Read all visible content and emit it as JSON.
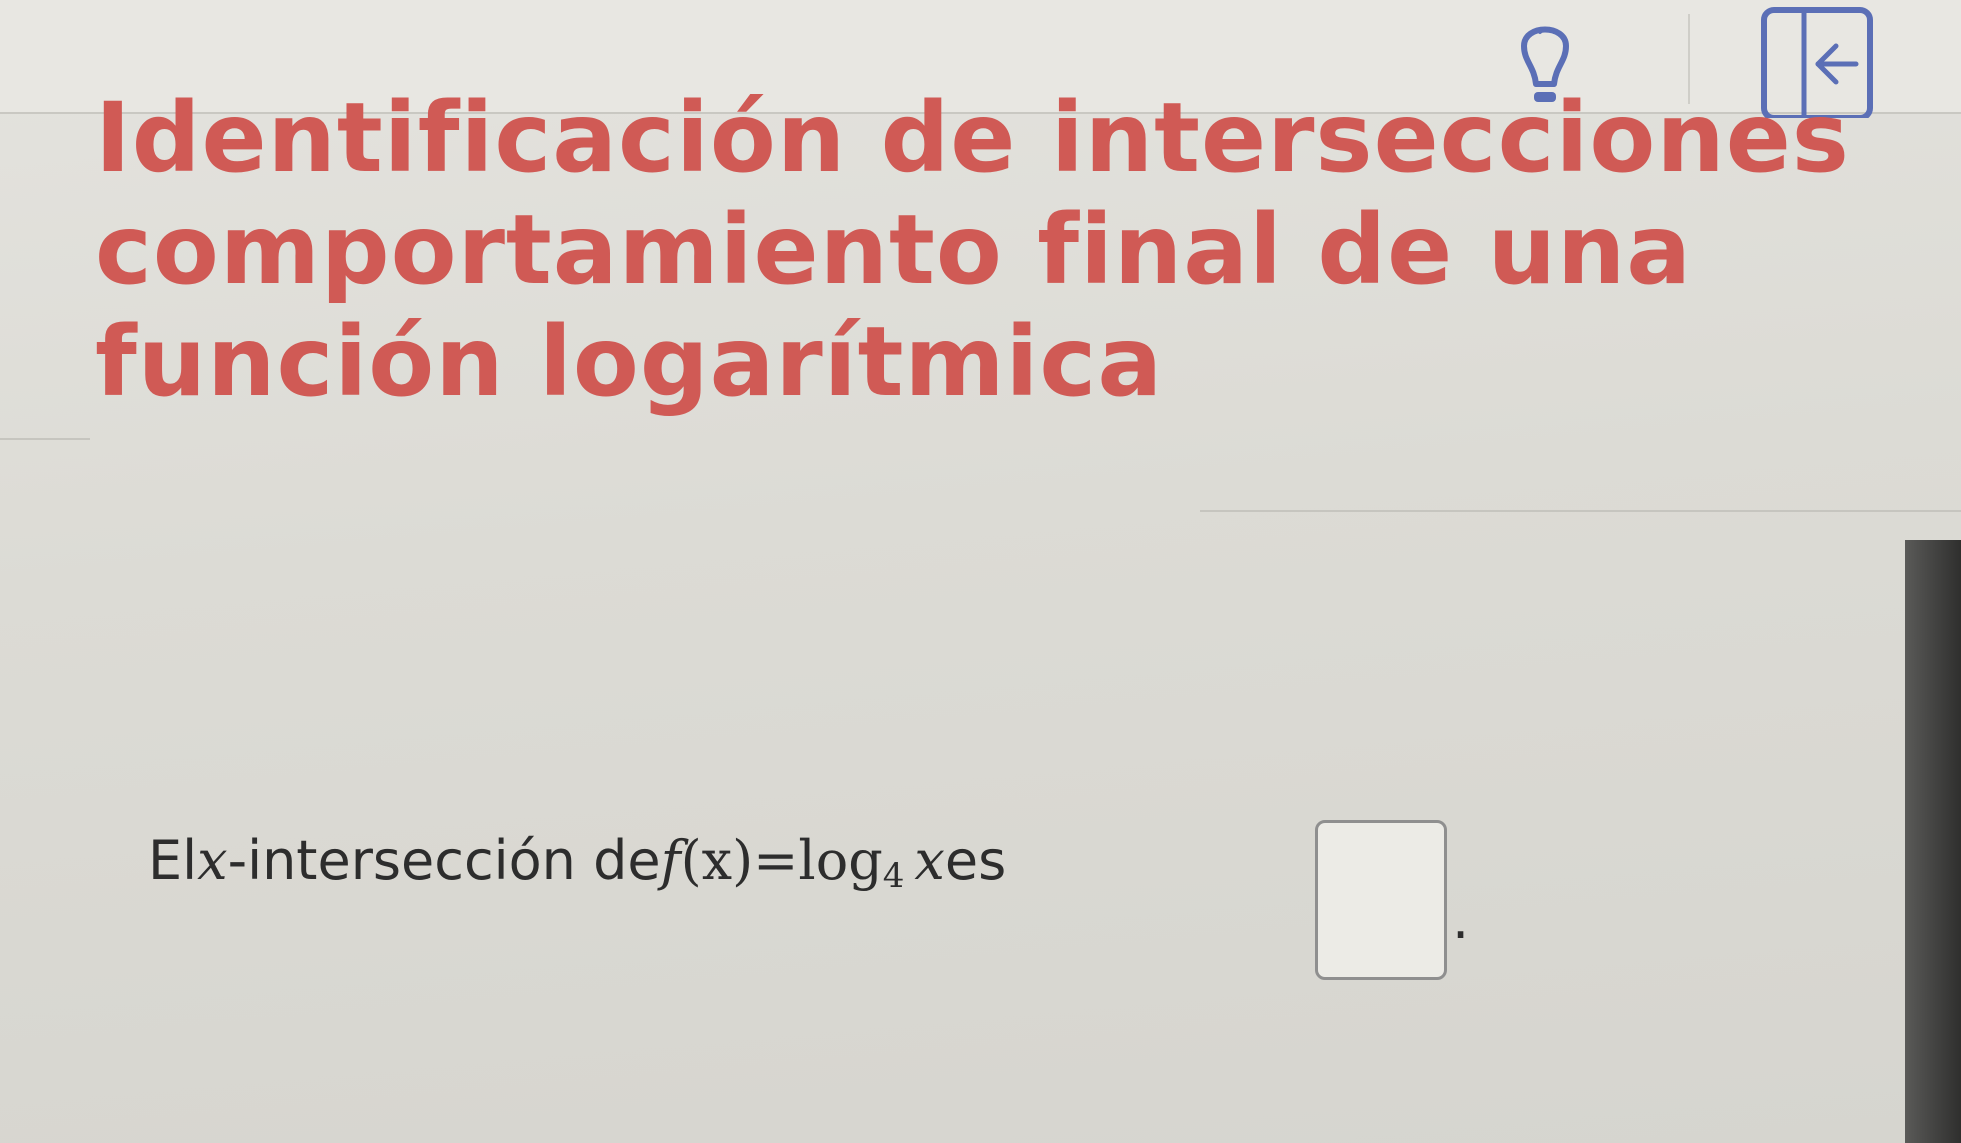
{
  "toolbar": {
    "hint_icon": "lightbulb-icon",
    "panel_icon": "collapse-panel-icon"
  },
  "title": {
    "line1": "Identificación de intersecciones",
    "line2": "comportamiento final de una",
    "line3": "función logarítmica"
  },
  "question": {
    "prefix": "El ",
    "variable": "x",
    "middle": "-intersección de ",
    "function_name": "f",
    "function_arg": "(x)",
    "equals": " = ",
    "log": "log",
    "base": "4",
    "argument": "x",
    "suffix": " es",
    "end": "."
  },
  "answer": {
    "value": ""
  },
  "colors": {
    "title": "#d05a55",
    "text": "#2d2d2d",
    "toolbar_icon": "#5b6fb6"
  }
}
